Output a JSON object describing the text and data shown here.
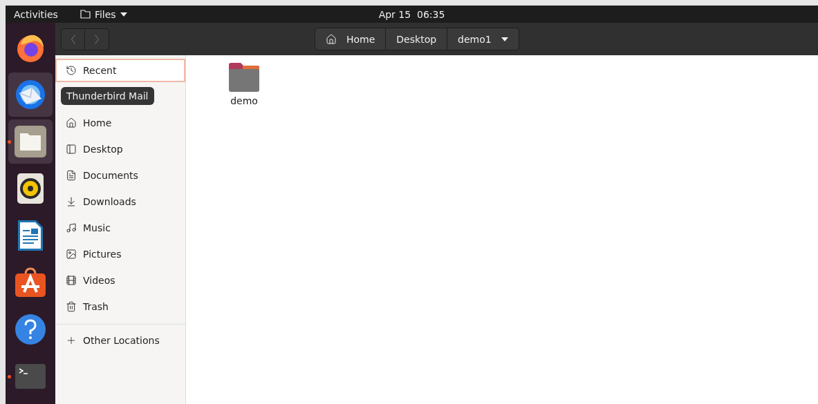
{
  "top_bar": {
    "activities": "Activities",
    "app_menu": "Files",
    "clock": "Apr 15  06:35"
  },
  "dock": [
    {
      "running": false,
      "highlighted": false
    },
    {
      "running": false,
      "highlighted": true
    },
    {
      "running": true,
      "highlighted": true
    },
    {
      "running": false,
      "highlighted": false
    },
    {
      "running": false,
      "highlighted": false
    },
    {
      "running": false,
      "highlighted": false
    },
    {
      "running": false,
      "highlighted": false
    },
    {
      "running": true,
      "highlighted": false
    }
  ],
  "tooltip": "Thunderbird Mail",
  "header": {
    "back": {
      "disabled": true
    },
    "forward": {
      "disabled": true
    },
    "path": [
      {
        "label": "Home"
      },
      {
        "label": "Desktop"
      },
      {
        "label": "demo1"
      }
    ]
  },
  "sidebar": {
    "items": [
      {
        "label": "Recent",
        "selected": true
      },
      {
        "label": "Home",
        "selected": false
      },
      {
        "label": "Desktop",
        "selected": false
      },
      {
        "label": "Documents",
        "selected": false
      },
      {
        "label": "Downloads",
        "selected": false
      },
      {
        "label": "Music",
        "selected": false
      },
      {
        "label": "Pictures",
        "selected": false
      },
      {
        "label": "Videos",
        "selected": false
      },
      {
        "label": "Trash",
        "selected": false
      }
    ],
    "other": "Other Locations"
  },
  "files": [
    {
      "name": "demo"
    }
  ]
}
